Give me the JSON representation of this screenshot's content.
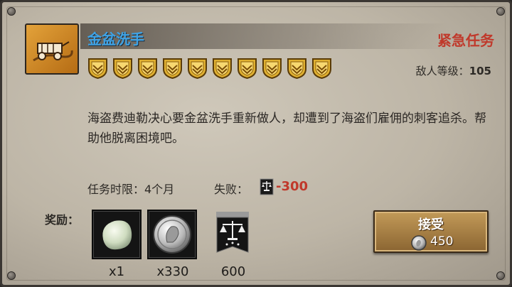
{
  "quest": {
    "title": "金盆洗手",
    "tag": "紧急任务",
    "star_count": 10,
    "enemy_level_label": "敌人等级：",
    "enemy_level_value": "105",
    "description": "海盗费迪勒决心要金盆洗手重新做人，却遭到了海盗们雇佣的刺客追杀。帮助他脱离困境吧。",
    "time_limit": "任务时限：4个月",
    "fail_label": "失败：",
    "fail_value": "-300"
  },
  "rewards": {
    "label": "奖励：",
    "items": [
      {
        "icon": "pearl-icon",
        "count": "x1"
      },
      {
        "icon": "silver-coin-icon",
        "count": "x330"
      },
      {
        "icon": "justice-banner-icon",
        "count": "600"
      }
    ]
  },
  "accept": {
    "label": "接受",
    "cost": "450",
    "cost_icon": "silver-coin-icon"
  },
  "colors": {
    "title": "#3fa3e6",
    "urgent": "#c0392b",
    "fail": "#c0392b",
    "shield_gold": "#e0b030"
  }
}
